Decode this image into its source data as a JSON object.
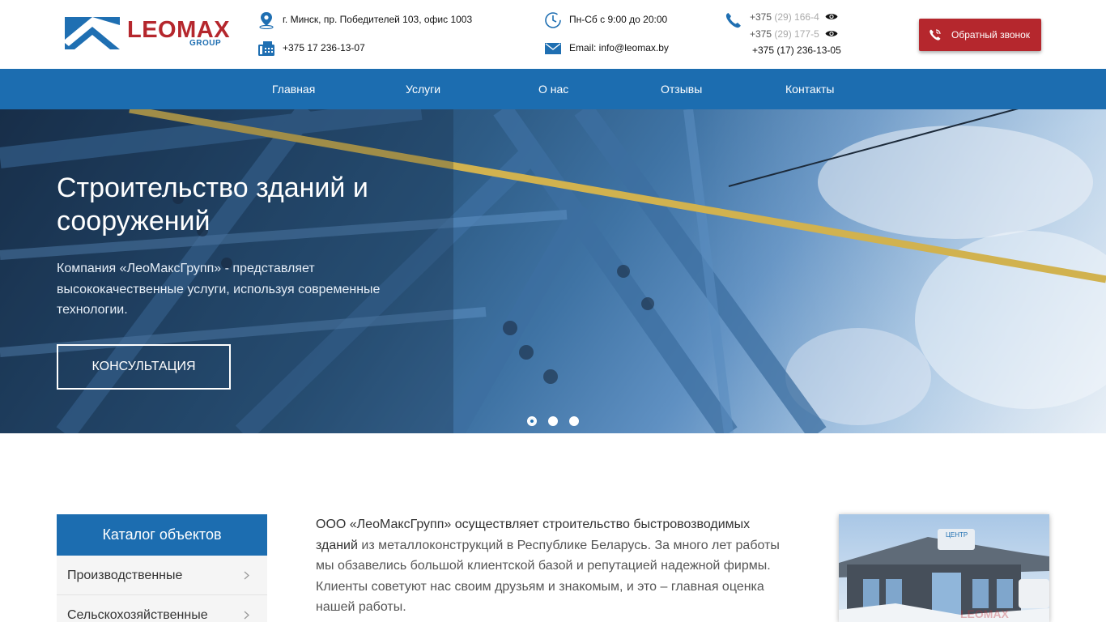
{
  "header": {
    "logo_word": "LEOMAX",
    "logo_sub": "GROUP",
    "address": "г. Минск, пр. Победителей 103, офис 1003",
    "fax_phone": "+375 17 236-13-07",
    "hours": "Пн-Сб с 9:00 до 20:00",
    "email": "Email: info@leomax.by",
    "phones": [
      {
        "visible": "+375 ",
        "hidden": "(29) 166-4"
      },
      {
        "visible": "+375 ",
        "hidden": "(29) 177-5"
      }
    ],
    "phone_full": "+375 (17) 236-13-05",
    "callback_label": "Обратный звонок"
  },
  "nav": {
    "items": [
      "Главная",
      "Услуги",
      "О нас",
      "Отзывы",
      "Контакты"
    ]
  },
  "hero": {
    "title": "Строительство зданий и сооружений",
    "text": "Компания «ЛеоМаксГрупп» - представляет высококачественные услуги, используя современные технологии.",
    "button": "КОНСУЛЬТАЦИЯ",
    "slides_total": 3,
    "active_slide": 1
  },
  "catalog": {
    "title": "Каталог объектов",
    "items": [
      "Производственные",
      "Сельскохозяйственные"
    ]
  },
  "about": {
    "strong": "ООО «ЛеоМаксГрупп» осуществляет строительство быстровозводимых зданий",
    "rest": " из металлоконструкций в Республике Беларусь. За много лет работы мы обзавелись большой клиентской базой и репутацией надежной фирмы. Клиенты советуют нас своим друзьям и знакомым, и это – главная оценка нашей работы."
  },
  "photo": {
    "sign_text": "ЦЕНТР"
  },
  "icons": {
    "address": "map-pin-icon",
    "fax": "fax-icon",
    "hours": "clock-icon",
    "email": "mail-icon",
    "phone": "phone-icon",
    "reveal": "eye-icon",
    "callback": "phone-ring-icon",
    "chevron": "chevron-right-icon"
  },
  "colors": {
    "brand_blue": "#1c6db0",
    "brand_red": "#b5272d"
  }
}
